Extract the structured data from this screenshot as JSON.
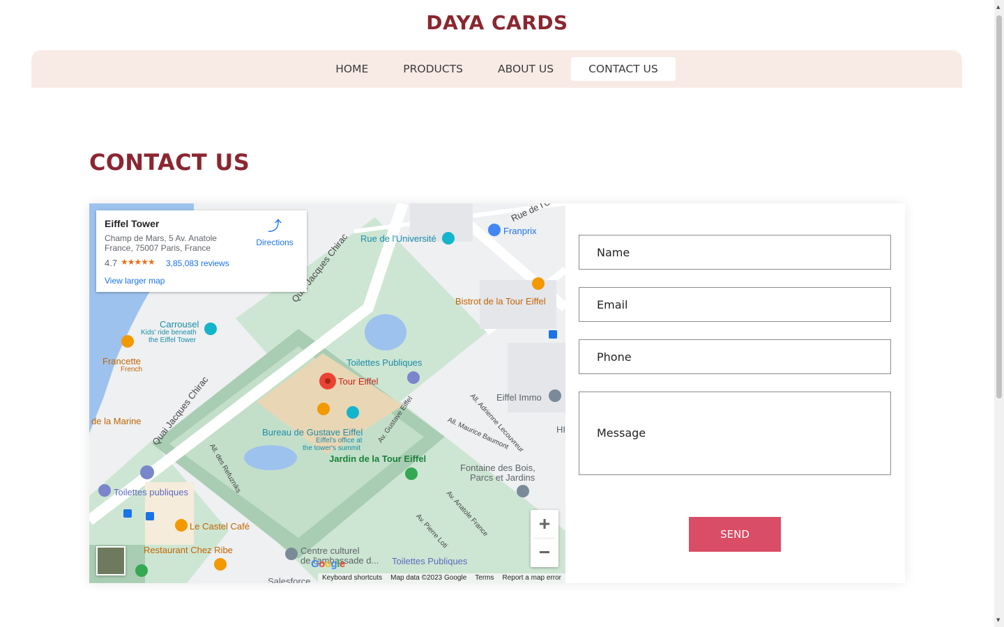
{
  "site": {
    "brand": "DAYA CARDS"
  },
  "nav": {
    "items": [
      {
        "label": "HOME"
      },
      {
        "label": "PRODUCTS"
      },
      {
        "label": "ABOUT US"
      },
      {
        "label": "CONTACT US"
      }
    ],
    "active": "CONTACT US"
  },
  "page": {
    "title": "CONTACT US"
  },
  "map": {
    "place_name": "Eiffel Tower",
    "address": "Champ de Mars, 5 Av. Anatole France, 75007 Paris, France",
    "rating": "4.7",
    "stars": "★★★★★",
    "reviews": "3,85,083 reviews",
    "larger_map": "View larger map",
    "directions": "Directions",
    "labels": {
      "rue_universite": "Rue de l'Université",
      "franprix": "Franprix",
      "rue_de": "Rue de l'U",
      "quai_chirac_top": "Quai Jacques Chirac",
      "quai_chirac_bottom": "Quai Jacques Chirac",
      "bistrot": "Bistrot de la Tour Eiffel",
      "carrousel": "Carrousel",
      "carrousel_sub1": "Kids' ride beneath",
      "carrousel_sub2": "the Eiffel Tower",
      "francette": "Francette",
      "francette_sub": "French",
      "toilettes_top": "Toilettes Publiques",
      "tour_eiffel": "Tour Eiffel",
      "eiffel_immo": "Eiffel Immo",
      "de_la_marine": "de la Marine",
      "bureau": "Bureau de Gustave Eiffel",
      "bureau_sub1": "Eiffel's office at",
      "bureau_sub2": "the tower's summit",
      "jardin": "Jardin de la Tour Eiffel",
      "av_gustave": "Av. Gustave Eiffel",
      "all_adrienne": "All. Adrienne Lecouvreur",
      "all_maurice": "All. Maurice Baumont",
      "fontaine": "Fontaine des Bois,",
      "fontaine2": "Parcs et Jardins",
      "all_refuzniks": "All. des Refuzniks",
      "av_anatole": "Av. Anatole France",
      "av_pierre": "Av. Pierre Loti",
      "toilettes_left": "Toilettes publiques",
      "castel": "Le Castel Café",
      "chez_ribe": "Restaurant Chez Ribe",
      "centre": "Centre culturel",
      "centre2": "de l'ambassade d...",
      "toilettes_bottom": "Toilettes Publiques",
      "salesforce": "Salesforce",
      "google": "Google",
      "hi": "HI"
    },
    "attribution": {
      "shortcuts": "Keyboard shortcuts",
      "data": "Map data ©2023 Google",
      "terms": "Terms",
      "report": "Report a map error"
    },
    "zoom_in": "+",
    "zoom_out": "−"
  },
  "form": {
    "name_placeholder": "Name",
    "email_placeholder": "Email",
    "phone_placeholder": "Phone",
    "message_placeholder": "Message",
    "send_label": "SEND"
  },
  "colors": {
    "brand": "#8b2630",
    "nav_bg": "#f8ebe6",
    "send_bg": "#d94d66"
  },
  "icons": [
    "directions-icon",
    "map-pin-icon",
    "camera-icon",
    "restaurant-icon",
    "toilet-icon",
    "parking-icon",
    "bus-icon",
    "shopping-icon",
    "zoom-in-icon",
    "zoom-out-icon"
  ]
}
